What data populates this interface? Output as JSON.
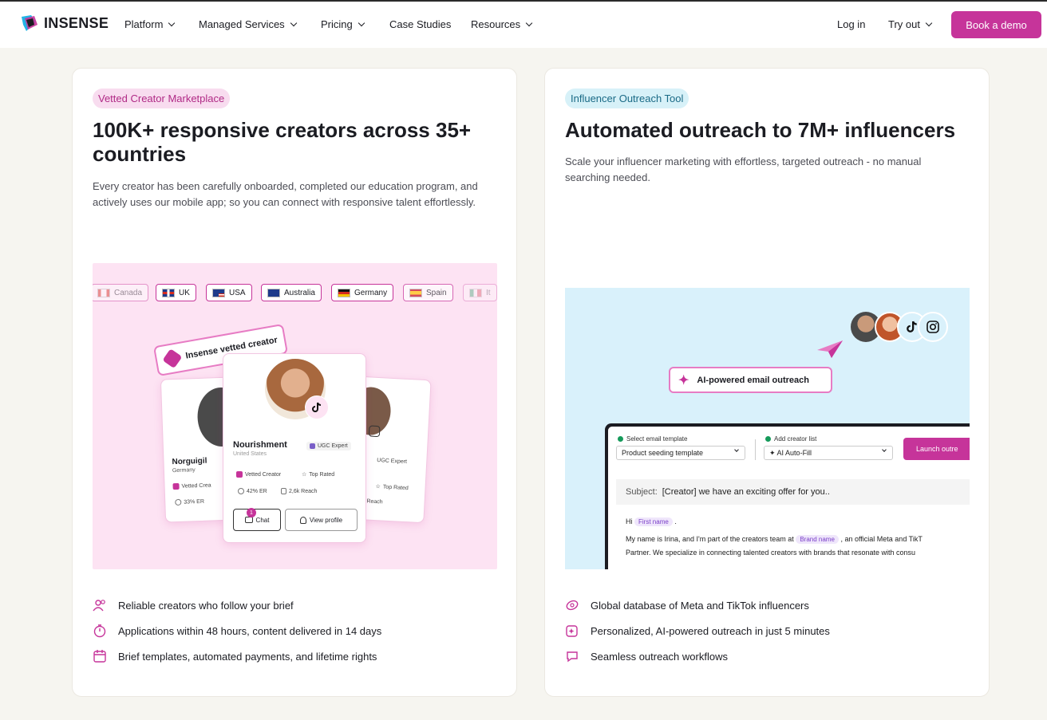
{
  "nav": {
    "logo_text": "INSENSE",
    "items": [
      {
        "label": "Platform",
        "has_dropdown": true
      },
      {
        "label": "Managed Services",
        "has_dropdown": true
      },
      {
        "label": "Pricing",
        "has_dropdown": true
      },
      {
        "label": "Case Studies",
        "has_dropdown": false
      },
      {
        "label": "Resources",
        "has_dropdown": true
      }
    ],
    "login": "Log in",
    "try_out": "Try out",
    "book_demo": "Book a demo"
  },
  "left_card": {
    "pill": "Vetted Creator Marketplace",
    "title": "100K+ responsive creators across 35+ countries",
    "description": "Every creator has been carefully onboarded, completed our education program, and actively uses our mobile app; so you can connect with responsive talent effortlessly.",
    "illustration": {
      "flags": [
        "Canada",
        "UK",
        "USA",
        "Australia",
        "Germany",
        "Spain",
        "It"
      ],
      "vetted_badge": "Insense vetted creator",
      "main_creator": {
        "name": "Nourishment",
        "location": "United States",
        "tag": "UGC Expert",
        "vetted": "Vetted Creator",
        "rated": "Top Rated",
        "er": "42% ER",
        "reach": "2,6k Reach",
        "chat": "Chat",
        "chat_count": "1",
        "view_profile": "View profile"
      },
      "left_creator": {
        "name": "Norguigil",
        "location": "Germany",
        "vetted": "Vetted Crea",
        "er": "33% ER"
      },
      "right_creator": {
        "tag": "UGC Expert",
        "rated": "Top Rated",
        "reach": "6 Reach"
      }
    },
    "features": [
      "Reliable creators who follow your brief",
      "Applications within 48 hours, content delivered in 14 days",
      "Brief templates, automated payments, and lifetime rights"
    ]
  },
  "right_card": {
    "pill": "Influencer Outreach Tool",
    "title": "Automated outreach to 7M+ influencers",
    "description": "Scale your influencer marketing with effortless, targeted outreach - no manual searching needed.",
    "illustration": {
      "ai_label": "AI-powered email outreach",
      "select_template_label": "Select email template",
      "template_value": "Product seeding template",
      "add_list_label": "Add creator list",
      "list_value": "✦ AI Auto-Fill",
      "launch": "Launch outre",
      "subject_label": "Subject:",
      "subject_value": "[Creator] we have an exciting offer for you..",
      "hi": "Hi",
      "first_name_chip": "First name",
      "body_line1_a": "My name is Irina, and I'm part of the creators team at",
      "brand_chip": "Brand name",
      "body_line1_b": ", an official Meta and TikT",
      "body_line2": "Partner. We specialize in connecting talented creators with brands that resonate with consu"
    },
    "features": [
      "Global database of Meta and TikTok influencers",
      "Personalized, AI-powered outreach in just 5 minutes",
      "Seamless outreach workflows"
    ]
  },
  "colors": {
    "accent": "#c6349a",
    "pink_bg": "#fde3f3",
    "blue_bg": "#d9f1fb",
    "page_bg": "#f6f5f0"
  }
}
